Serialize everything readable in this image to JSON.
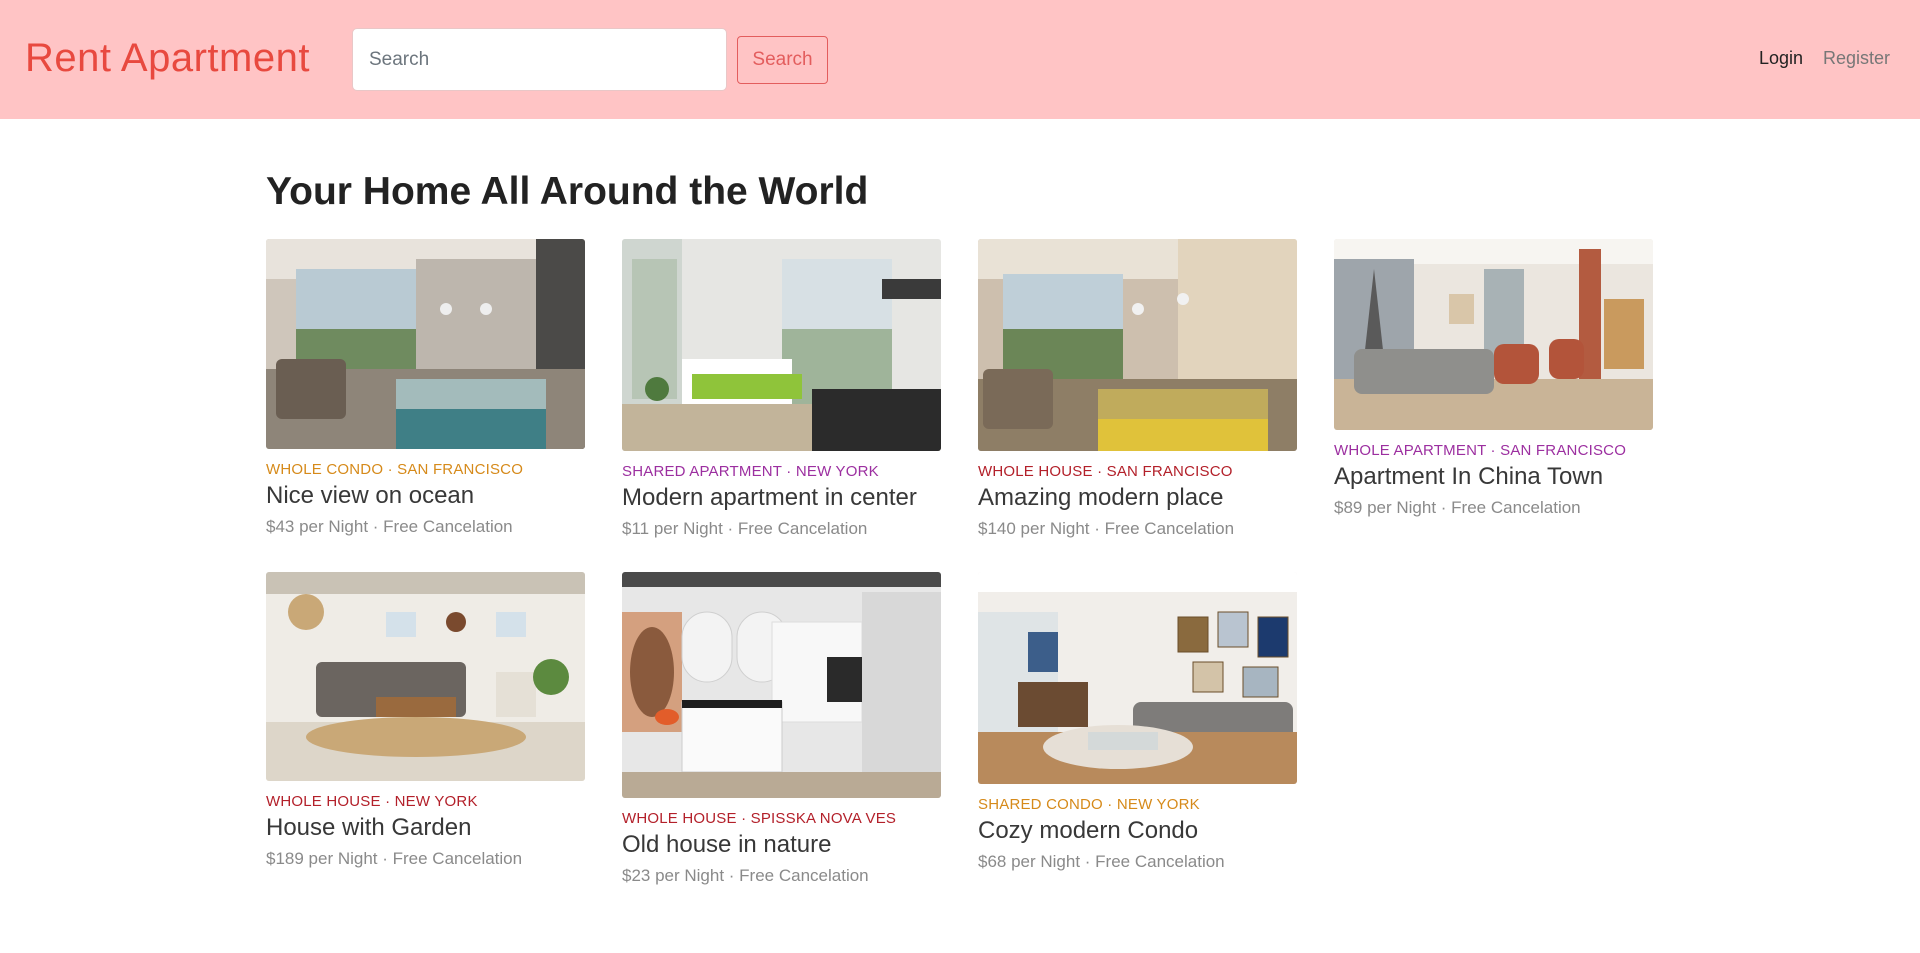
{
  "navbar": {
    "brand": "Rent Apartment",
    "search_placeholder": "Search",
    "search_button": "Search",
    "login": "Login",
    "register": "Register"
  },
  "main": {
    "title": "Your Home All Around the World",
    "listings": [
      {
        "type": "Whole Condo",
        "city": "San Francisco",
        "meta": "WHOLE CONDO · SAN FRANCISCO",
        "title": "Nice view on ocean",
        "price_line": "$43 per Night · Free Cancelation",
        "accent": "#d68a1a"
      },
      {
        "type": "Shared Apartment",
        "city": "New York",
        "meta": "SHARED APARTMENT · NEW YORK",
        "title": "Modern apartment in center",
        "price_line": "$11 per Night · Free Cancelation",
        "accent": "#9c2fa0"
      },
      {
        "type": "Whole House",
        "city": "San Francisco",
        "meta": "WHOLE HOUSE · SAN FRANCISCO",
        "title": "Amazing modern place",
        "price_line": "$140 per Night · Free Cancelation",
        "accent": "#b3202a"
      },
      {
        "type": "Whole Apartment",
        "city": "San Francisco",
        "meta": "WHOLE APARTMENT · SAN FRANCISCO",
        "title": "Apartment In China Town",
        "price_line": "$89 per Night · Free Cancelation",
        "accent": "#9c2fa0"
      },
      {
        "type": "Whole House",
        "city": "New York",
        "meta": "WHOLE HOUSE · NEW YORK",
        "title": "House with Garden",
        "price_line": "$189 per Night · Free Cancelation",
        "accent": "#b3202a"
      },
      {
        "type": "Whole House",
        "city": "Spisska Nova Ves",
        "meta": "WHOLE HOUSE · SPISSKA NOVA VES",
        "title": "Old house in nature",
        "price_line": "$23 per Night · Free Cancelation",
        "accent": "#b3202a"
      },
      {
        "type": "Shared Condo",
        "city": "New York",
        "meta": "SHARED CONDO · NEW YORK",
        "title": "Cozy modern Condo",
        "price_line": "$68 per Night · Free Cancelation",
        "accent": "#d68a1a"
      }
    ]
  },
  "colors": {
    "navbar_bg": "#ffc4c5",
    "brand": "#e8493f",
    "search_button": "#e35d5d"
  }
}
